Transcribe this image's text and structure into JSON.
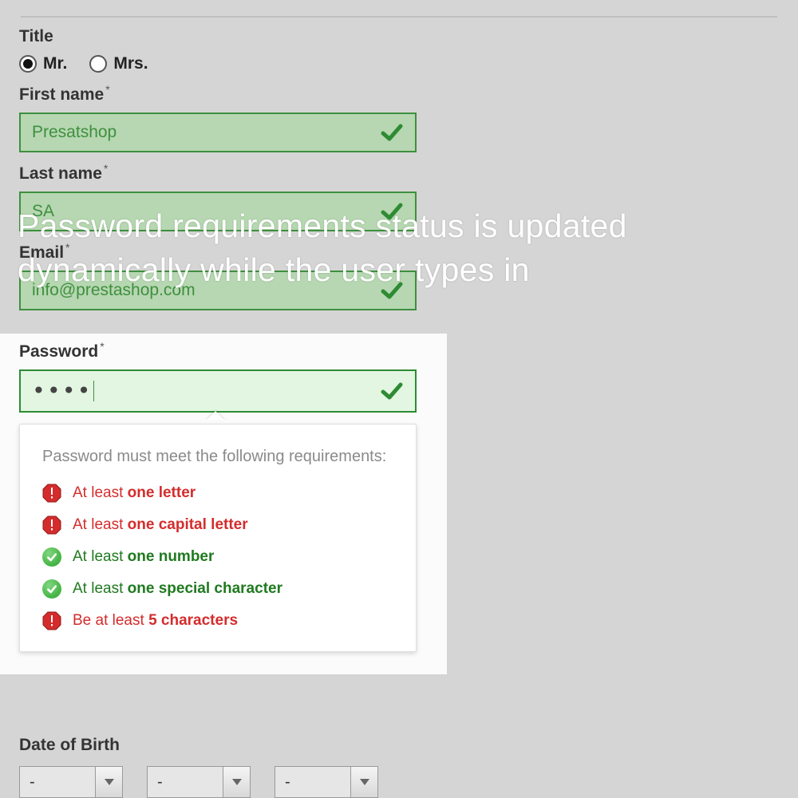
{
  "form": {
    "title_label": "Title",
    "radios": {
      "mr": "Mr.",
      "mrs": "Mrs.",
      "selected": "mr"
    },
    "first_name_label": "First name",
    "first_name_value": "Presatshop",
    "last_name_label": "Last name",
    "last_name_value": "SA",
    "email_label": "Email",
    "email_value": "info@prestashop.com",
    "password_label": "Password",
    "password_mask": "••••",
    "dob_label": "Date of Birth",
    "dob_values": {
      "day": "-",
      "month": "-",
      "year": "-"
    },
    "required_mark": "*"
  },
  "requirements": {
    "title": "Password must meet the following requirements:",
    "items": [
      {
        "status": "fail",
        "pre": "At least ",
        "bold": "one letter"
      },
      {
        "status": "fail",
        "pre": "At least ",
        "bold": "one capital letter"
      },
      {
        "status": "ok",
        "pre": "At least ",
        "bold": "one number"
      },
      {
        "status": "ok",
        "pre": "At least ",
        "bold": "one special character"
      },
      {
        "status": "fail",
        "pre": "Be at least  ",
        "bold": "5 characters"
      }
    ]
  },
  "overlay_caption": "Password requirements status is updated dynamically while the user types in"
}
